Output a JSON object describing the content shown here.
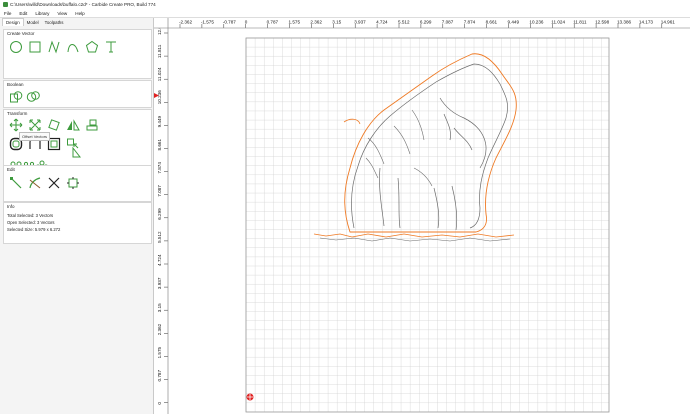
{
  "window": {
    "title": "C:\\Users\\willd\\Downloads\\buffalo.c2d* - Carbide Create PRO, Build 774"
  },
  "menu": [
    "File",
    "Edit",
    "Library",
    "View",
    "Help"
  ],
  "left_panel": {
    "tabs": [
      "Design",
      "Model",
      "Toolpaths"
    ],
    "sections": {
      "create_vector": "Create Vector",
      "boolean": "Boolean",
      "transform": "Transform",
      "edit": "Edit",
      "info": "Info"
    },
    "tooltip": "Offset Vectors",
    "info": {
      "total_selected": "Total Selected:  3 Vectors",
      "open_selected": "Open Selected:  3 Vectors",
      "selected_size": "Selected Size:    5.979 x 6.272"
    }
  },
  "rulers": {
    "x_ticks": [
      "-2.362",
      "-1.575",
      "-0.787",
      "0",
      "0.787",
      "1.575",
      "2.362",
      "3.15",
      "3.937",
      "4.724",
      "5.512",
      "6.299",
      "7.087",
      "7.874",
      "8.661",
      "9.449",
      "10.236",
      "11.024",
      "11.811",
      "12.598",
      "13.386",
      "14.173",
      "14.961"
    ],
    "y_ticks": [
      "12.6",
      "11.811",
      "11.024",
      "10.236",
      "9.449",
      "8.661",
      "7.874",
      "7.087",
      "6.299",
      "5.512",
      "4.724",
      "3.937",
      "3.15",
      "2.362",
      "1.575",
      "0.787",
      "0"
    ]
  },
  "colors": {
    "vector_gray": "#6b6b6b",
    "selected_orange": "#ef7a24",
    "tool_green": "#3d9b3d",
    "origin_red": "#e02020",
    "grid": "#d3d3d3"
  },
  "icons": {
    "create_vector": [
      "circle-icon",
      "rectangle-icon",
      "polyline-icon",
      "curve-icon",
      "polygon-icon",
      "text-icon"
    ],
    "boolean": [
      "boolean-union-icon",
      "boolean-subtract-icon"
    ],
    "transform_row1": [
      "move-icon",
      "scale-icon",
      "rotate-icon",
      "mirror-icon",
      "align-icon"
    ],
    "transform_row2": [
      "offset-vectors-icon",
      "offset-outline-icon",
      "fillet-icon",
      "select-icon",
      "triangle-group-icon"
    ],
    "transform_row3": [
      "distribute-circles-icon",
      "array-icon",
      "circle-pattern-icon"
    ],
    "edit": [
      "node-edit-icon",
      "trim-icon",
      "cut-icon",
      "join-icon"
    ]
  }
}
